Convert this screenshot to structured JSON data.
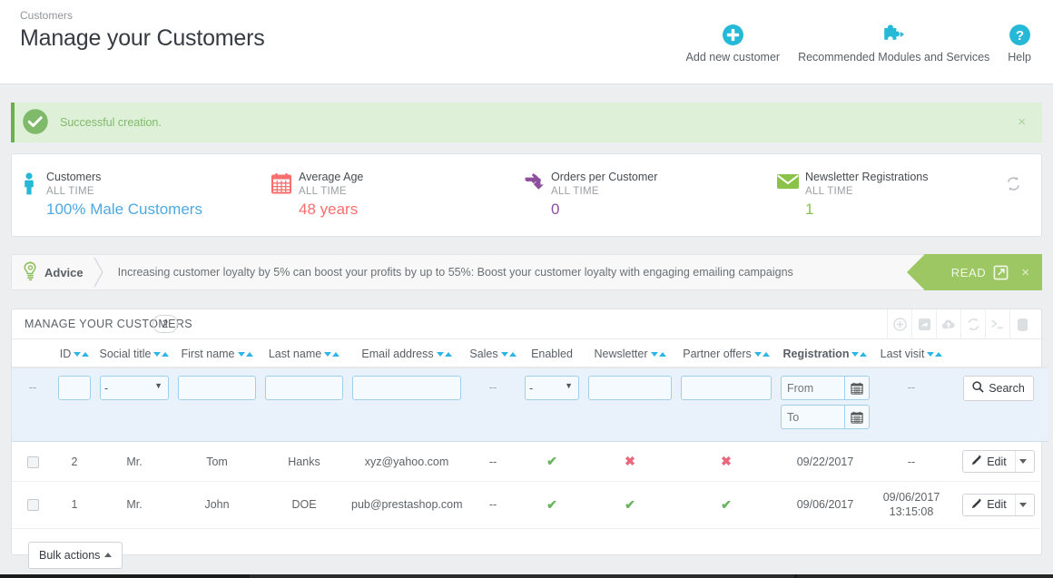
{
  "header": {
    "breadcrumb": "Customers",
    "title": "Manage your Customers",
    "actions": [
      {
        "icon": "plus-circle-icon",
        "label": "Add new customer"
      },
      {
        "icon": "puzzle-piece-icon",
        "label": "Recommended Modules and Services"
      },
      {
        "icon": "question-circle-icon",
        "label": "Help"
      }
    ]
  },
  "alert": {
    "icon": "check-circle-icon",
    "message": "Successful creation.",
    "close_label": "×",
    "bg_color": "#dff0d8",
    "accent_color": "#6ab04c"
  },
  "kpis": {
    "refresh_icon": "refresh-icon",
    "items": [
      {
        "icon": "person-icon",
        "icon_color": "#25b9d7",
        "title": "Customers",
        "subtitle": "ALL TIME",
        "value": "100% Male Customers",
        "value_color": "#4da9e0"
      },
      {
        "icon": "calendar-icon",
        "icon_color": "#fa6e6e",
        "title": "Average Age",
        "subtitle": "ALL TIME",
        "value": "48 years",
        "value_color": "#fa6e6e"
      },
      {
        "icon": "exchange-icon",
        "icon_color": "#8c4f9e",
        "title": "Orders per Customer",
        "subtitle": "ALL TIME",
        "value": "0",
        "value_color": "#8c4f9e"
      },
      {
        "icon": "envelope-icon",
        "icon_color": "#8bc34a",
        "title": "Newsletter Registrations",
        "subtitle": "ALL TIME",
        "value": "1",
        "value_color": "#8bc34a"
      }
    ]
  },
  "advice": {
    "icon": "lightbulb-icon",
    "label": "Advice",
    "text": "Increasing customer loyalty by 5% can boost your profits by up to 55%: Boost your customer loyalty with engaging emailing campaigns",
    "read_label": "READ",
    "read_icon": "external-link-icon",
    "close_label": "×",
    "accent_color": "#9cc763"
  },
  "list": {
    "title": "MANAGE YOUR CUSTOMERS",
    "count": "2",
    "tools": [
      {
        "icon": "add-new-icon",
        "name": "add-new"
      },
      {
        "icon": "export-icon",
        "name": "export"
      },
      {
        "icon": "import-icon",
        "name": "import"
      },
      {
        "icon": "refresh-icon",
        "name": "refresh-list"
      },
      {
        "icon": "terminal-icon",
        "name": "sql-query"
      },
      {
        "icon": "database-icon",
        "name": "show-sql-query"
      }
    ],
    "columns": [
      {
        "label": "",
        "sortable": false,
        "sorted": false
      },
      {
        "label": "ID",
        "sortable": true,
        "sorted": false
      },
      {
        "label": "Social title",
        "sortable": true,
        "sorted": false
      },
      {
        "label": "First name",
        "sortable": true,
        "sorted": false
      },
      {
        "label": "Last name",
        "sortable": true,
        "sorted": false
      },
      {
        "label": "Email address",
        "sortable": true,
        "sorted": false
      },
      {
        "label": "Sales",
        "sortable": true,
        "sorted": false
      },
      {
        "label": "Enabled",
        "sortable": false,
        "sorted": false
      },
      {
        "label": "Newsletter",
        "sortable": true,
        "sorted": false
      },
      {
        "label": "Partner offers",
        "sortable": true,
        "sorted": false
      },
      {
        "label": "Registration",
        "sortable": true,
        "sorted": true
      },
      {
        "label": "Last visit",
        "sortable": true,
        "sorted": false
      },
      {
        "label": "",
        "sortable": false,
        "sorted": false
      }
    ],
    "filters": {
      "checkbox_dash": "--",
      "id_value": "",
      "social_title_value": "-",
      "first_name_value": "",
      "last_name_value": "",
      "email_value": "",
      "sales_dash": "--",
      "enabled_value": "-",
      "newsletter_value": "",
      "partner_offers_value": "",
      "registration_from_placeholder": "From",
      "registration_from_value": "",
      "registration_to_placeholder": "To",
      "registration_to_value": "",
      "last_visit_dash": "--",
      "search_label": "Search",
      "search_icon": "search-icon",
      "calendar_icon": "calendar-icon"
    },
    "rows": [
      {
        "id": "2",
        "social_title": "Mr.",
        "first_name": "Tom",
        "last_name": "Hanks",
        "email": "xyz@yahoo.com",
        "sales": "--",
        "enabled": "yes",
        "newsletter": "no",
        "partner_offers": "no",
        "registration": "09/22/2017",
        "last_visit": "--",
        "action_label": "Edit",
        "action_icon": "pencil-icon"
      },
      {
        "id": "1",
        "social_title": "Mr.",
        "first_name": "John",
        "last_name": "DOE",
        "email": "pub@prestashop.com",
        "sales": "--",
        "enabled": "yes",
        "newsletter": "yes",
        "partner_offers": "yes",
        "registration": "09/06/2017",
        "last_visit": "09/06/2017 13:15:08",
        "action_label": "Edit",
        "action_icon": "pencil-icon"
      }
    ],
    "bulk_actions_label": "Bulk actions",
    "yes_glyph": "✔",
    "no_glyph": "✖"
  }
}
